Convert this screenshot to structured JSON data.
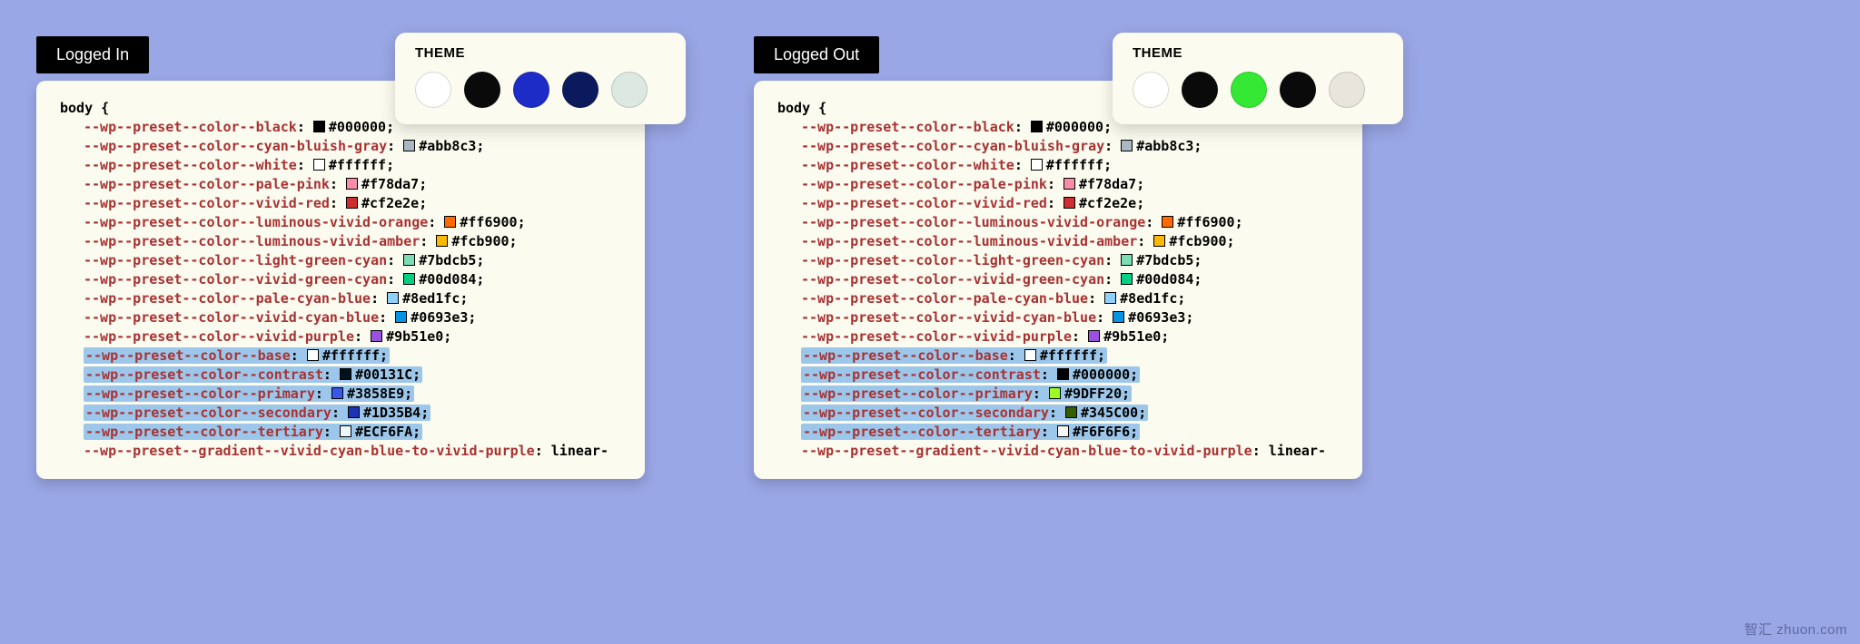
{
  "left": {
    "badge": "Logged In",
    "theme_label": "THEME",
    "swatches": [
      "#ffffff",
      "#0a0a0a",
      "#1d2cc7",
      "#0a1a5c",
      "#dce8e1"
    ],
    "selector": "body {",
    "lines": [
      {
        "var": "--wp--preset--color--black",
        "chip": "#000000",
        "val": "#000000",
        "hl": false
      },
      {
        "var": "--wp--preset--color--cyan-bluish-gray",
        "chip": "#abb8c3",
        "val": "#abb8c3",
        "hl": false
      },
      {
        "var": "--wp--preset--color--white",
        "chip": "#ffffff",
        "val": "#ffffff",
        "hl": false
      },
      {
        "var": "--wp--preset--color--pale-pink",
        "chip": "#f78da7",
        "val": "#f78da7",
        "hl": false
      },
      {
        "var": "--wp--preset--color--vivid-red",
        "chip": "#cf2e2e",
        "val": "#cf2e2e",
        "hl": false
      },
      {
        "var": "--wp--preset--color--luminous-vivid-orange",
        "chip": "#ff6900",
        "val": "#ff6900",
        "hl": false
      },
      {
        "var": "--wp--preset--color--luminous-vivid-amber",
        "chip": "#fcb900",
        "val": "#fcb900",
        "hl": false
      },
      {
        "var": "--wp--preset--color--light-green-cyan",
        "chip": "#7bdcb5",
        "val": "#7bdcb5",
        "hl": false
      },
      {
        "var": "--wp--preset--color--vivid-green-cyan",
        "chip": "#00d084",
        "val": "#00d084",
        "hl": false
      },
      {
        "var": "--wp--preset--color--pale-cyan-blue",
        "chip": "#8ed1fc",
        "val": "#8ed1fc",
        "hl": false
      },
      {
        "var": "--wp--preset--color--vivid-cyan-blue",
        "chip": "#0693e3",
        "val": "#0693e3",
        "hl": false
      },
      {
        "var": "--wp--preset--color--vivid-purple",
        "chip": "#9b51e0",
        "val": "#9b51e0",
        "hl": false
      },
      {
        "var": "--wp--preset--color--base",
        "chip": "#ffffff",
        "val": "#ffffff",
        "hl": true
      },
      {
        "var": "--wp--preset--color--contrast",
        "chip": "#00131C",
        "val": "#00131C",
        "hl": true
      },
      {
        "var": "--wp--preset--color--primary",
        "chip": "#3858E9",
        "val": "#3858E9",
        "hl": true
      },
      {
        "var": "--wp--preset--color--secondary",
        "chip": "#1D35B4",
        "val": "#1D35B4",
        "hl": true
      },
      {
        "var": "--wp--preset--color--tertiary",
        "chip": "#ECF6FA",
        "val": "#ECF6FA",
        "hl": true
      }
    ],
    "trailing": {
      "var": "--wp--preset--gradient--vivid-cyan-blue-to-vivid-purple",
      "val": "linear-"
    }
  },
  "right": {
    "badge": "Logged Out",
    "theme_label": "THEME",
    "swatches": [
      "#ffffff",
      "#0a0a0a",
      "#34e834",
      "#0a0a0a",
      "#e8e6dc"
    ],
    "selector": "body {",
    "lines": [
      {
        "var": "--wp--preset--color--black",
        "chip": "#000000",
        "val": "#000000",
        "hl": false
      },
      {
        "var": "--wp--preset--color--cyan-bluish-gray",
        "chip": "#abb8c3",
        "val": "#abb8c3",
        "hl": false
      },
      {
        "var": "--wp--preset--color--white",
        "chip": "#ffffff",
        "val": "#ffffff",
        "hl": false
      },
      {
        "var": "--wp--preset--color--pale-pink",
        "chip": "#f78da7",
        "val": "#f78da7",
        "hl": false
      },
      {
        "var": "--wp--preset--color--vivid-red",
        "chip": "#cf2e2e",
        "val": "#cf2e2e",
        "hl": false
      },
      {
        "var": "--wp--preset--color--luminous-vivid-orange",
        "chip": "#ff6900",
        "val": "#ff6900",
        "hl": false
      },
      {
        "var": "--wp--preset--color--luminous-vivid-amber",
        "chip": "#fcb900",
        "val": "#fcb900",
        "hl": false
      },
      {
        "var": "--wp--preset--color--light-green-cyan",
        "chip": "#7bdcb5",
        "val": "#7bdcb5",
        "hl": false
      },
      {
        "var": "--wp--preset--color--vivid-green-cyan",
        "chip": "#00d084",
        "val": "#00d084",
        "hl": false
      },
      {
        "var": "--wp--preset--color--pale-cyan-blue",
        "chip": "#8ed1fc",
        "val": "#8ed1fc",
        "hl": false
      },
      {
        "var": "--wp--preset--color--vivid-cyan-blue",
        "chip": "#0693e3",
        "val": "#0693e3",
        "hl": false
      },
      {
        "var": "--wp--preset--color--vivid-purple",
        "chip": "#9b51e0",
        "val": "#9b51e0",
        "hl": false
      },
      {
        "var": "--wp--preset--color--base",
        "chip": "#ffffff",
        "val": "#ffffff",
        "hl": true
      },
      {
        "var": "--wp--preset--color--contrast",
        "chip": "#000000",
        "val": "#000000",
        "hl": true
      },
      {
        "var": "--wp--preset--color--primary",
        "chip": "#9DFF20",
        "val": "#9DFF20",
        "hl": true
      },
      {
        "var": "--wp--preset--color--secondary",
        "chip": "#345C00",
        "val": "#345C00",
        "hl": true
      },
      {
        "var": "--wp--preset--color--tertiary",
        "chip": "#F6F6F6",
        "val": "#F6F6F6",
        "hl": true
      }
    ],
    "trailing": {
      "var": "--wp--preset--gradient--vivid-cyan-blue-to-vivid-purple",
      "val": "linear-"
    }
  },
  "watermark": {
    "zh": "智汇",
    "en": "zhuon.com"
  }
}
